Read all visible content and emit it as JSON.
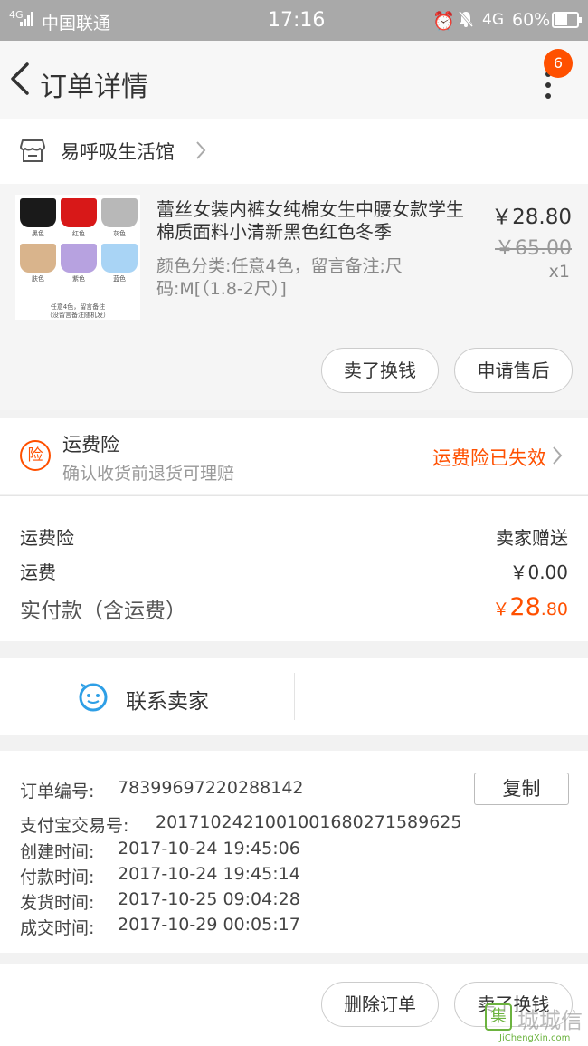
{
  "status_bar": {
    "signal_label": "4G",
    "carrier": "中国联通",
    "time": "17:16",
    "network": "4G",
    "battery": "60%",
    "battery_level": 0.6
  },
  "header": {
    "title": "订单详情",
    "badge_count": "6"
  },
  "shop": {
    "name": "易呼吸生活馆"
  },
  "product": {
    "title": "蕾丝女装内裤女纯棉女生中腰女款学生棉质面料小清新黑色红色冬季",
    "sku": "颜色分类:任意4色，留言备注;尺码:M[（1.8-2尺）]",
    "price": "￥28.80",
    "original_price": "￥65.00",
    "quantity": "x1",
    "thumbnail": {
      "swatches": [
        {
          "label": "黑色",
          "color": "#1a1a1a"
        },
        {
          "label": "红色",
          "color": "#d81818"
        },
        {
          "label": "灰色",
          "color": "#b8b8b8"
        },
        {
          "label": "肤色",
          "color": "#d9b48c"
        },
        {
          "label": "紫色",
          "color": "#b7a2e0"
        },
        {
          "label": "蓝色",
          "color": "#a9d4f5"
        }
      ],
      "note_line1": "任意4色，留言备注",
      "note_line2": "（没留言备注随机发）"
    },
    "buttons": {
      "sell": "卖了换钱",
      "after_sale": "申请售后"
    }
  },
  "insurance": {
    "icon_char": "险",
    "title": "运费险",
    "subtitle": "确认收货前退货可理赔",
    "status": "运费险已失效"
  },
  "fees": {
    "insurance_label": "运费险",
    "insurance_value": "卖家赠送",
    "shipping_label": "运费",
    "shipping_value": "￥0.00",
    "total_label": "实付款（含运费）",
    "total_currency": "￥",
    "total_integer": "28",
    "total_decimal": ".80"
  },
  "contact": {
    "label": "联系卖家"
  },
  "order_info": {
    "order_no_label": "订单编号:",
    "order_no": "78399697220288142",
    "copy_label": "复制",
    "alipay_label": "支付宝交易号:",
    "alipay_no": "2017102421001001680271589625",
    "created_label": "创建时间:",
    "created": "2017-10-24 19:45:06",
    "paid_label": "付款时间:",
    "paid": "2017-10-24 19:45:14",
    "shipped_label": "发货时间:",
    "shipped": "2017-10-25 09:04:28",
    "completed_label": "成交时间:",
    "completed": "2017-10-29 00:05:17"
  },
  "bottom_bar": {
    "delete": "删除订单",
    "sell": "卖了换钱"
  },
  "watermark": {
    "logo_char": "集",
    "text": "城城信",
    "url": "JiChengXin.com"
  },
  "colors": {
    "accent": "#ff5000",
    "contact_icon": "#2e9fe6"
  }
}
